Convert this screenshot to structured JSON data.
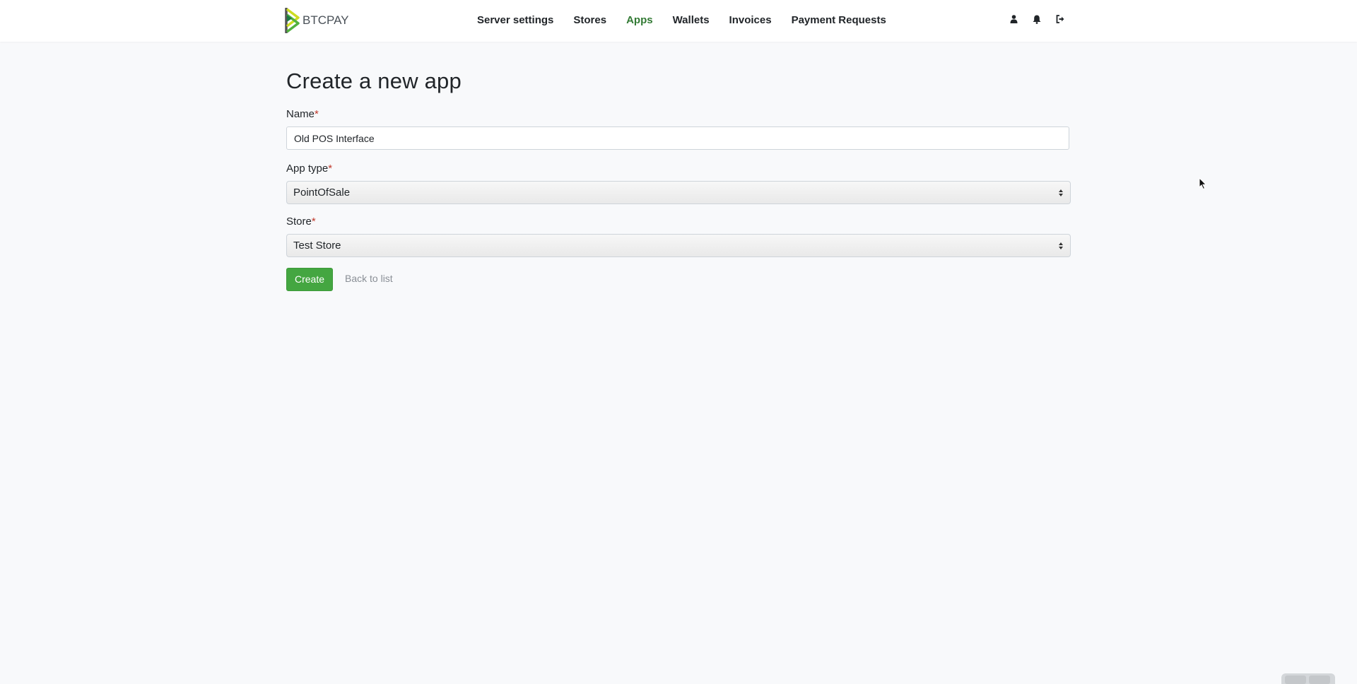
{
  "brand": {
    "logo_text": "BTCPAY",
    "accent_color": "#44a641",
    "nav_active_color": "#327a34"
  },
  "nav": {
    "items": [
      {
        "label": "Server settings",
        "active": false
      },
      {
        "label": "Stores",
        "active": false
      },
      {
        "label": "Apps",
        "active": true
      },
      {
        "label": "Wallets",
        "active": false
      },
      {
        "label": "Invoices",
        "active": false
      },
      {
        "label": "Payment Requests",
        "active": false
      }
    ],
    "icons": [
      "user-icon",
      "bell-icon",
      "sign-out-icon"
    ]
  },
  "page": {
    "title": "Create a new app"
  },
  "form": {
    "name": {
      "label": "Name",
      "required_mark": "*",
      "value": "Old POS Interface"
    },
    "app_type": {
      "label": "App type",
      "required_mark": "*",
      "selected": "PointOfSale"
    },
    "store": {
      "label": "Store",
      "required_mark": "*",
      "selected": "Test Store"
    },
    "create_label": "Create",
    "back_label": "Back to list"
  }
}
